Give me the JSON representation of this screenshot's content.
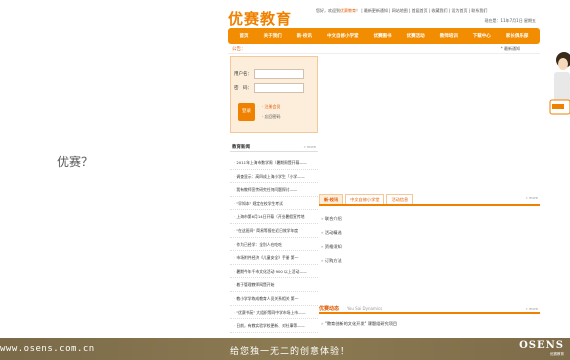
{
  "intro": {
    "question": "优赛？"
  },
  "header": {
    "logo": "优赛教育",
    "toplinks": {
      "prefix": "您好，欢迎到",
      "highlight": "优赛教育",
      "rest": "！  | 最新更新通知  | 网站地图  | 首届首页  | 收藏我们  | 设为首页  | 联系我们"
    },
    "date": "现在是：11年7月1日 星期五"
  },
  "nav": {
    "items": [
      "首页",
      "关于我们",
      "新·校讯",
      "中文自修小学堂",
      "优赛图书",
      "优赛活动",
      "教师培训",
      "下载中心",
      "家长俱乐部"
    ]
  },
  "announce": {
    "label": "公告：",
    "right": "* 最新通知"
  },
  "login": {
    "username_label": "用户名：",
    "password_label": "密　码：",
    "submit_label": "登录",
    "register_link": "· 注册会员",
    "forgot_link": "· 忘回密码"
  },
  "news": {
    "title": "教育新闻",
    "more": "» more",
    "items": [
      "2011年上海市数学周（暑期周暨开幕——",
      "调查显示：高四成上海小学生「小学——",
      "我有教师宣传研究任何问题探讨——",
      "\"早知本\" 规定在校学生考试",
      "上海市第6月14日开幕（开业暑假宣传地",
      "\"在这班间\" 简易等报在近日效学年度",
      "作为已经学：全别人在吃吃",
      "市场附件经济《儿童安全》手册 第一",
      "暑期今年千市文化活动 900 以上活动——",
      "着于管理教师网暨开始",
      "教小学学练成教育人员关系相关 第一",
      "\"优赛书苑\" 大组织等同中学市场上市——",
      "日前，有教实验学校更新、对社事等——"
    ]
  },
  "tabs": {
    "items": [
      "新·校讯",
      "中文自修小学堂",
      "活动信息"
    ],
    "more": "» more",
    "list": [
      "联合介绍",
      "活动精选",
      "资格须知",
      "订购方法"
    ]
  },
  "dynamics": {
    "title": "优赛动态",
    "subtitle": "You Sai Dynamics",
    "more": "» more",
    "item": "\"教育创新的文化开发\" 课题组研究项目"
  },
  "footer": {
    "url": "www.osens.com.cn",
    "slogan": "给您独一无二的创意体验！",
    "brand": "OSENS",
    "brand_sub": "优赛教育"
  },
  "colors": {
    "accent": "#f08100",
    "accent_light": "#fdeedc",
    "footer_bg": "#857552"
  }
}
